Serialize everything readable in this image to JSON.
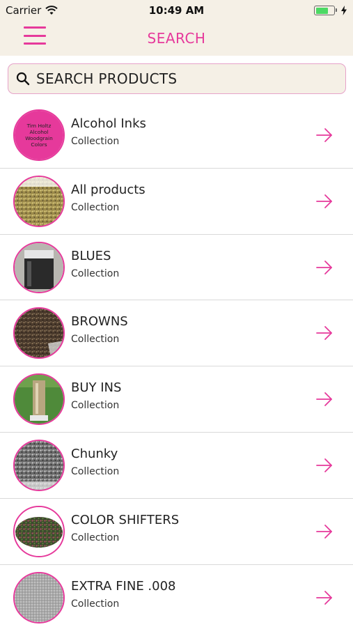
{
  "status_bar": {
    "carrier": "Carrier",
    "time": "10:49 AM",
    "battery_level": 0.7
  },
  "nav": {
    "title": "SEARCH",
    "menu_icon": "hamburger-menu-icon"
  },
  "search": {
    "placeholder": "SEARCH PRODUCTS",
    "value": "",
    "icon": "search-icon"
  },
  "colors": {
    "accent": "#e6399b",
    "header_bg": "#f5f0e6"
  },
  "collections": [
    {
      "title": "Alcohol Inks",
      "subtitle": "Collection",
      "thumb_kind": "label",
      "thumb_text": [
        "Tim Holtz",
        "Alcohol",
        "Woodgrain",
        "Colors"
      ]
    },
    {
      "title": "All products",
      "subtitle": "Collection",
      "thumb_kind": "glitter-gold"
    },
    {
      "title": "BLUES",
      "subtitle": "Collection",
      "thumb_kind": "jar"
    },
    {
      "title": "BROWNS",
      "subtitle": "Collection",
      "thumb_kind": "glitter-brown"
    },
    {
      "title": "BUY INS",
      "subtitle": "Collection",
      "thumb_kind": "tumbler"
    },
    {
      "title": "Chunky",
      "subtitle": "Collection",
      "thumb_kind": "glitter-silver"
    },
    {
      "title": "COLOR SHIFTERS",
      "subtitle": "Collection",
      "thumb_kind": "glitter-multi"
    },
    {
      "title": "EXTRA FINE .008",
      "subtitle": "Collection",
      "thumb_kind": "glitter-fine"
    }
  ],
  "row_arrow_icon": "arrow-right-icon"
}
